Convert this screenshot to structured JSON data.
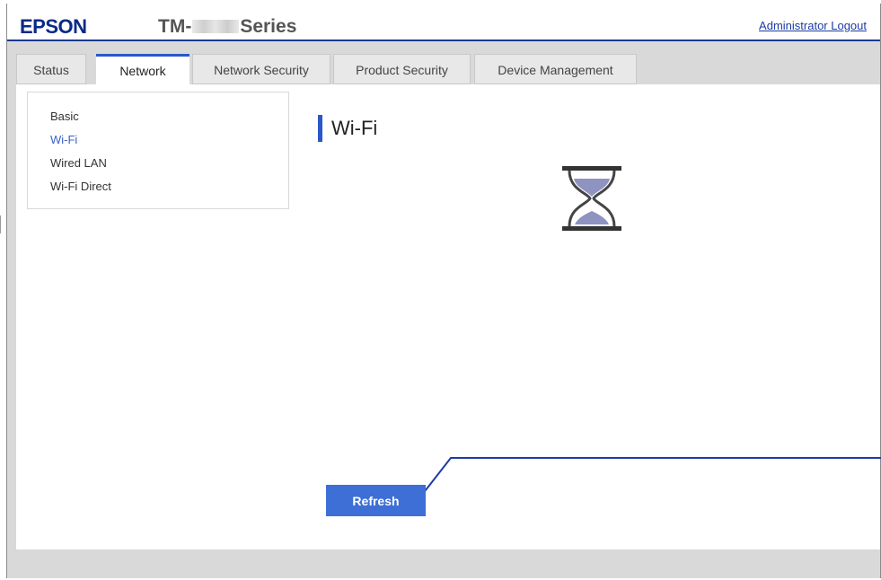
{
  "header": {
    "brand": "EPSON",
    "model_prefix": "TM-",
    "model_suffix": "Series",
    "logout_label": "Administrator Logout"
  },
  "tabs": [
    {
      "label": "Status"
    },
    {
      "label": "Network",
      "active": true
    },
    {
      "label": "Network Security"
    },
    {
      "label": "Product Security"
    },
    {
      "label": "Device Management"
    }
  ],
  "subnav": {
    "items": [
      {
        "label": "Basic"
      },
      {
        "label": "Wi-Fi",
        "active": true
      },
      {
        "label": "Wired LAN"
      },
      {
        "label": "Wi-Fi Direct"
      }
    ]
  },
  "main": {
    "title": "Wi-Fi",
    "loading_icon": "hourglass-icon",
    "refresh_label": "Refresh"
  },
  "colors": {
    "brand": "#0a2a88",
    "accent": "#2a57c9",
    "button": "#3d6fd6",
    "active_link": "#3a62c9"
  }
}
